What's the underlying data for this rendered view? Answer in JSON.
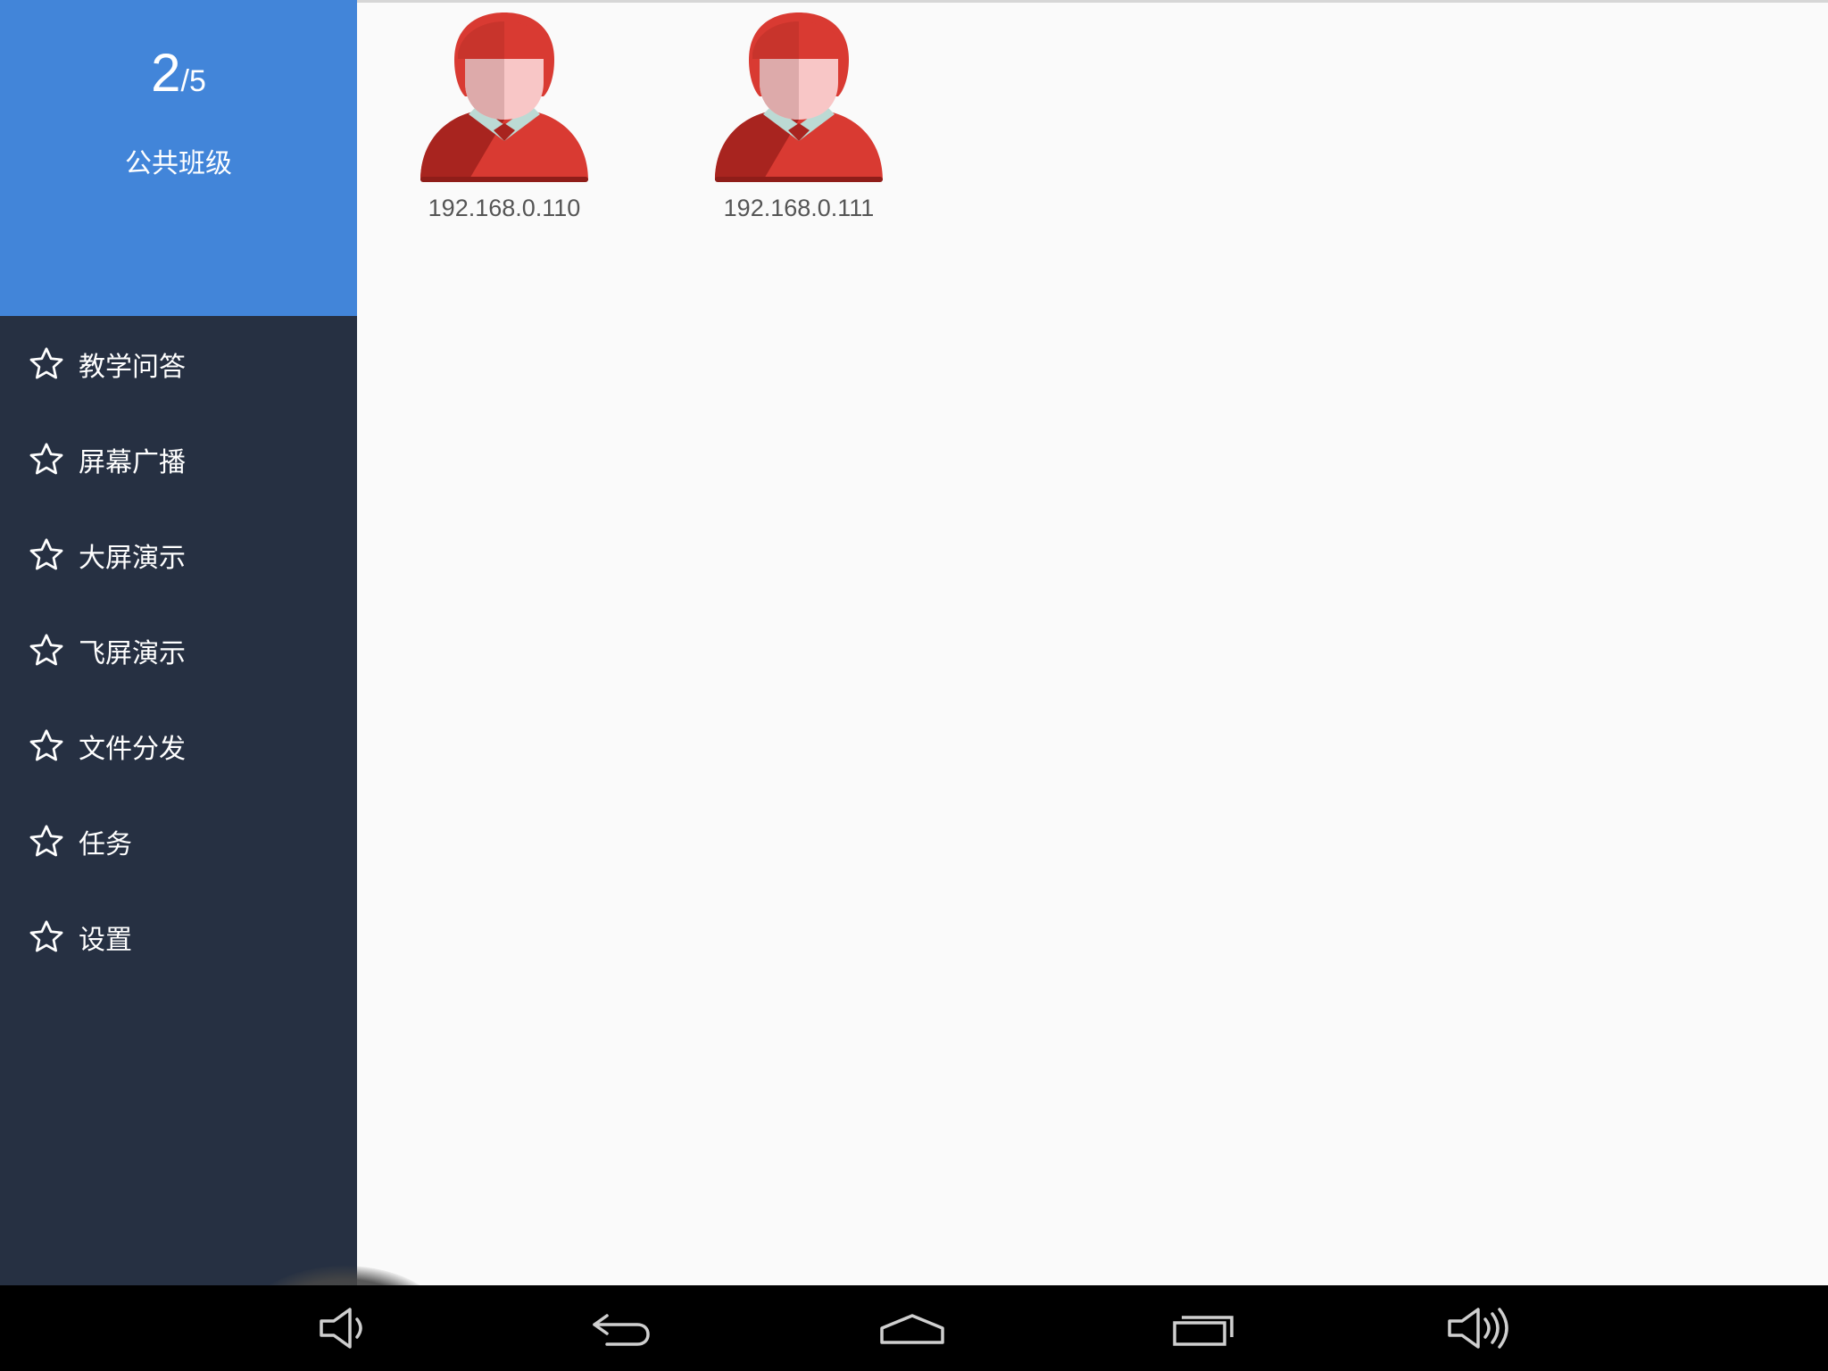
{
  "header": {
    "current_count": "2",
    "separator": "/",
    "total_count": "5",
    "class_name": "公共班级"
  },
  "menu": {
    "items": [
      {
        "label": "教学问答",
        "icon": "star-outline-icon"
      },
      {
        "label": "屏幕广播",
        "icon": "star-outline-icon"
      },
      {
        "label": "大屏演示",
        "icon": "star-outline-icon"
      },
      {
        "label": "飞屏演示",
        "icon": "star-outline-icon"
      },
      {
        "label": "文件分发",
        "icon": "star-outline-icon"
      },
      {
        "label": "任务",
        "icon": "star-outline-icon"
      },
      {
        "label": "设置",
        "icon": "star-outline-icon"
      }
    ]
  },
  "students": [
    {
      "ip": "192.168.0.110",
      "icon": "student-avatar-icon"
    },
    {
      "ip": "192.168.0.111",
      "icon": "student-avatar-icon"
    }
  ],
  "navbar": {
    "buttons": [
      {
        "icon": "volume-down-icon"
      },
      {
        "icon": "back-icon"
      },
      {
        "icon": "home-icon"
      },
      {
        "icon": "recent-apps-icon"
      },
      {
        "icon": "volume-up-icon"
      }
    ]
  },
  "colors": {
    "sidebar_header": "#4285d9",
    "sidebar_bg": "#263042",
    "main_bg": "#fafafa",
    "avatar_red": "#d93a32",
    "navbar_bg": "#000000"
  }
}
